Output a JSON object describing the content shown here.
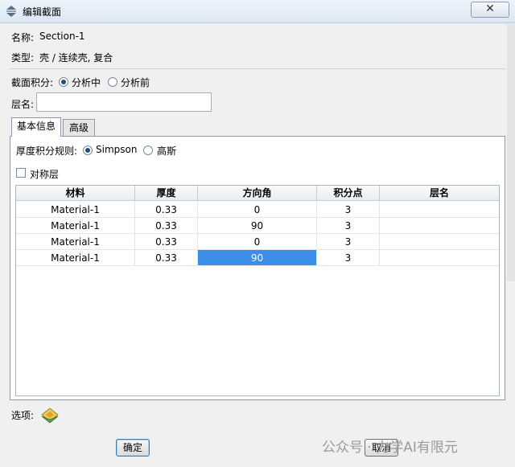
{
  "window": {
    "title": "编辑截面",
    "close_symbol": "✕"
  },
  "section": {
    "name_label": "名称:",
    "name_value": "Section-1",
    "type_label": "类型:",
    "type_value": "壳 / 连续壳, 复合"
  },
  "integration": {
    "label": "截面积分:",
    "options": [
      "分析中",
      "分析前"
    ],
    "selected": "分析中"
  },
  "layup": {
    "label": "层名:",
    "value": ""
  },
  "tabs": [
    {
      "label": "基本信息",
      "active": true
    },
    {
      "label": "高级",
      "active": false
    }
  ],
  "thickness_rule": {
    "label": "厚度积分规则:",
    "options": [
      "Simpson",
      "高斯"
    ],
    "selected": "Simpson"
  },
  "symmetric": {
    "label": "对称层",
    "checked": false
  },
  "table": {
    "columns": [
      "材料",
      "厚度",
      "方向角",
      "积分点",
      "层名"
    ],
    "rows": [
      [
        "Material-1",
        "0.33",
        "0",
        "3",
        ""
      ],
      [
        "Material-1",
        "0.33",
        "90",
        "3",
        ""
      ],
      [
        "Material-1",
        "0.33",
        "0",
        "3",
        ""
      ],
      [
        "Material-1",
        "0.33",
        "90",
        "3",
        ""
      ]
    ],
    "selected_cell": {
      "row": 3,
      "col": 2
    }
  },
  "options": {
    "label": "选项:",
    "icon": "layer-options-icon"
  },
  "buttons": {
    "ok": "确定",
    "cancel": "取消"
  },
  "watermark": "公众号 · 力学AI有限元"
}
